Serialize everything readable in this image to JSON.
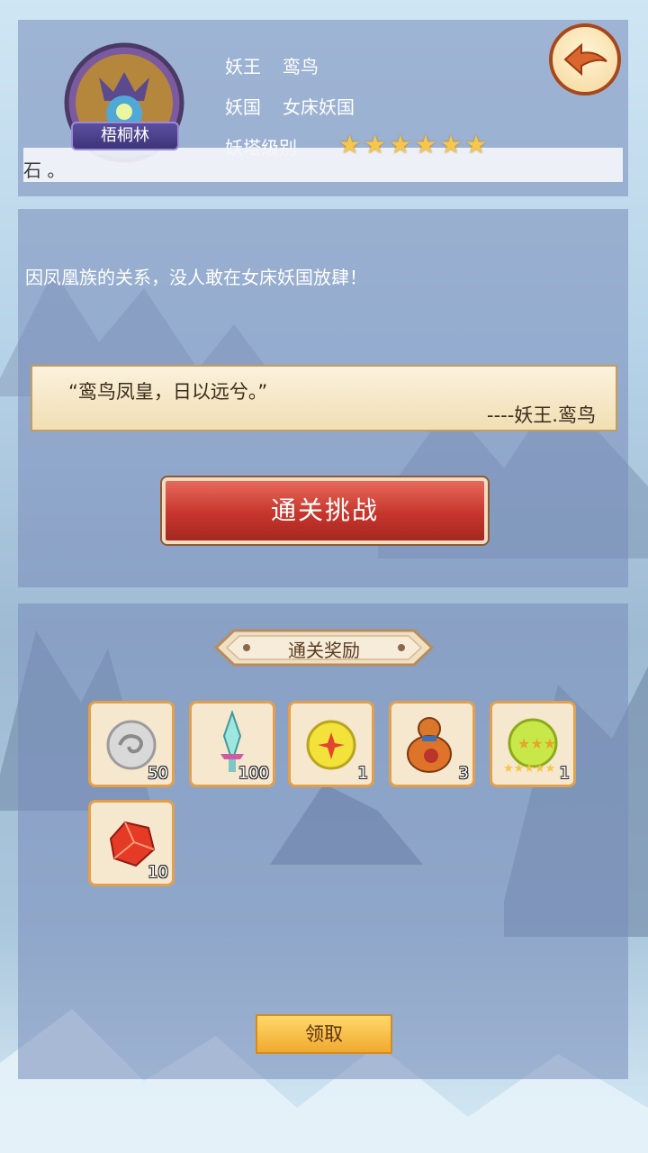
{
  "header": {
    "avatar_label": "梧桐林",
    "king_key": "妖王",
    "king_value": "鸾鸟",
    "country_key": "妖国",
    "country_value": "女床妖国",
    "level_key": "妖塔级别",
    "stars": 6,
    "scroll_text": "石 。"
  },
  "story": {
    "description": "因凤凰族的关系，没人敢在女床妖国放肆！",
    "quote": "“鸾鸟凤皇，日以远兮。”",
    "author": "----妖王.鸾鸟"
  },
  "challenge": {
    "label": "通关挑战"
  },
  "rewards": {
    "title": "通关奖励",
    "items": [
      {
        "icon": "silver-swirl-coin-icon",
        "count": "50"
      },
      {
        "icon": "crystal-sword-icon",
        "count": "100"
      },
      {
        "icon": "golden-orb-icon",
        "count": "1"
      },
      {
        "icon": "treasure-gourd-icon",
        "count": "3"
      },
      {
        "icon": "star-orb-icon",
        "count": "1"
      },
      {
        "icon": "red-gem-icon",
        "count": "10"
      }
    ],
    "receive_label": "领取"
  }
}
